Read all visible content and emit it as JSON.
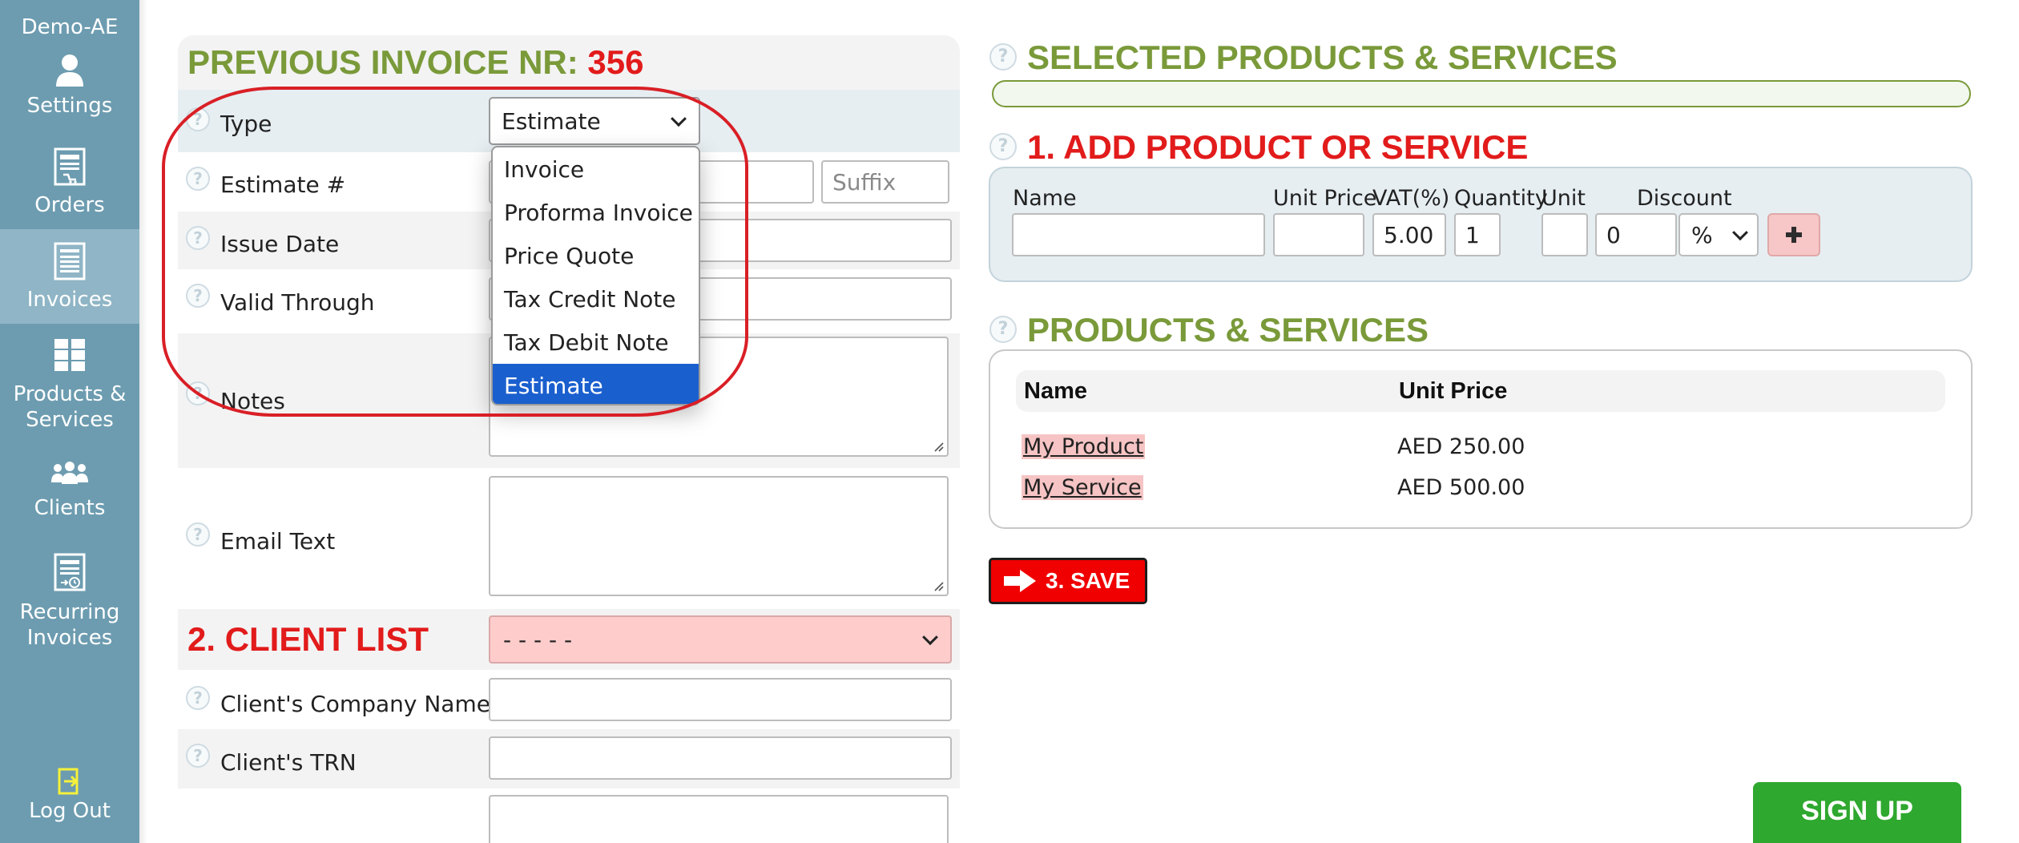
{
  "sidebar": {
    "company": "Demo-AE",
    "items": [
      {
        "label": "Settings",
        "icon": "user-icon"
      },
      {
        "label": "Orders",
        "icon": "orders-icon"
      },
      {
        "label": "Invoices",
        "icon": "invoice-icon"
      },
      {
        "label": "Products &",
        "label2": "Services",
        "icon": "grid-icon"
      },
      {
        "label": "Clients",
        "icon": "clients-icon"
      },
      {
        "label": "Recurring",
        "label2": "Invoices",
        "icon": "recurring-icon"
      },
      {
        "label": "Log Out",
        "icon": "logout-icon"
      }
    ]
  },
  "invoice": {
    "title_prefix": "PREVIOUS INVOICE NR:",
    "number": "356"
  },
  "form": {
    "type_label": "Type",
    "type_value": "Estimate",
    "estimate_label": "Estimate #",
    "suffix_placeholder": "Suffix",
    "issue_date_label": "Issue Date",
    "valid_through_label": "Valid Through",
    "notes_label": "Notes",
    "email_text_label": "Email Text"
  },
  "type_dropdown": {
    "options": [
      "Invoice",
      "Proforma Invoice",
      "Price Quote",
      "Tax Credit Note",
      "Tax Debit Note",
      "Estimate"
    ],
    "selected": "Estimate"
  },
  "client": {
    "title": "2. CLIENT LIST",
    "select_value": "- - - - -",
    "company_label": "Client's Company Name",
    "trn_label": "Client's TRN"
  },
  "selected_products": {
    "title": "SELECTED PRODUCTS & SERVICES"
  },
  "add_product": {
    "title": "1. ADD PRODUCT OR SERVICE",
    "labels": {
      "name": "Name",
      "unit_price": "Unit Price",
      "vat": "VAT(%)",
      "quantity": "Quantity",
      "unit": "Unit",
      "discount": "Discount"
    },
    "vat_value": "5.00",
    "quantity_value": "1",
    "discount_value": "0",
    "discount_type": "%"
  },
  "products": {
    "title": "PRODUCTS & SERVICES",
    "columns": [
      "Name",
      "Unit Price"
    ],
    "rows": [
      {
        "name": "My Product",
        "price": "AED 250.00"
      },
      {
        "name": "My Service",
        "price": "AED 500.00"
      }
    ]
  },
  "save_label": "3. SAVE",
  "signup_label": "SIGN UP",
  "colors": {
    "sidebar": "#6d9cb0",
    "sidebar_active": "#8fb5c6",
    "green_title": "#7a9a3a",
    "red_title": "#e21b1b",
    "selected_option": "#1a5fce",
    "signup": "#2ea82e",
    "annotation_ellipse": "#d91f26"
  }
}
